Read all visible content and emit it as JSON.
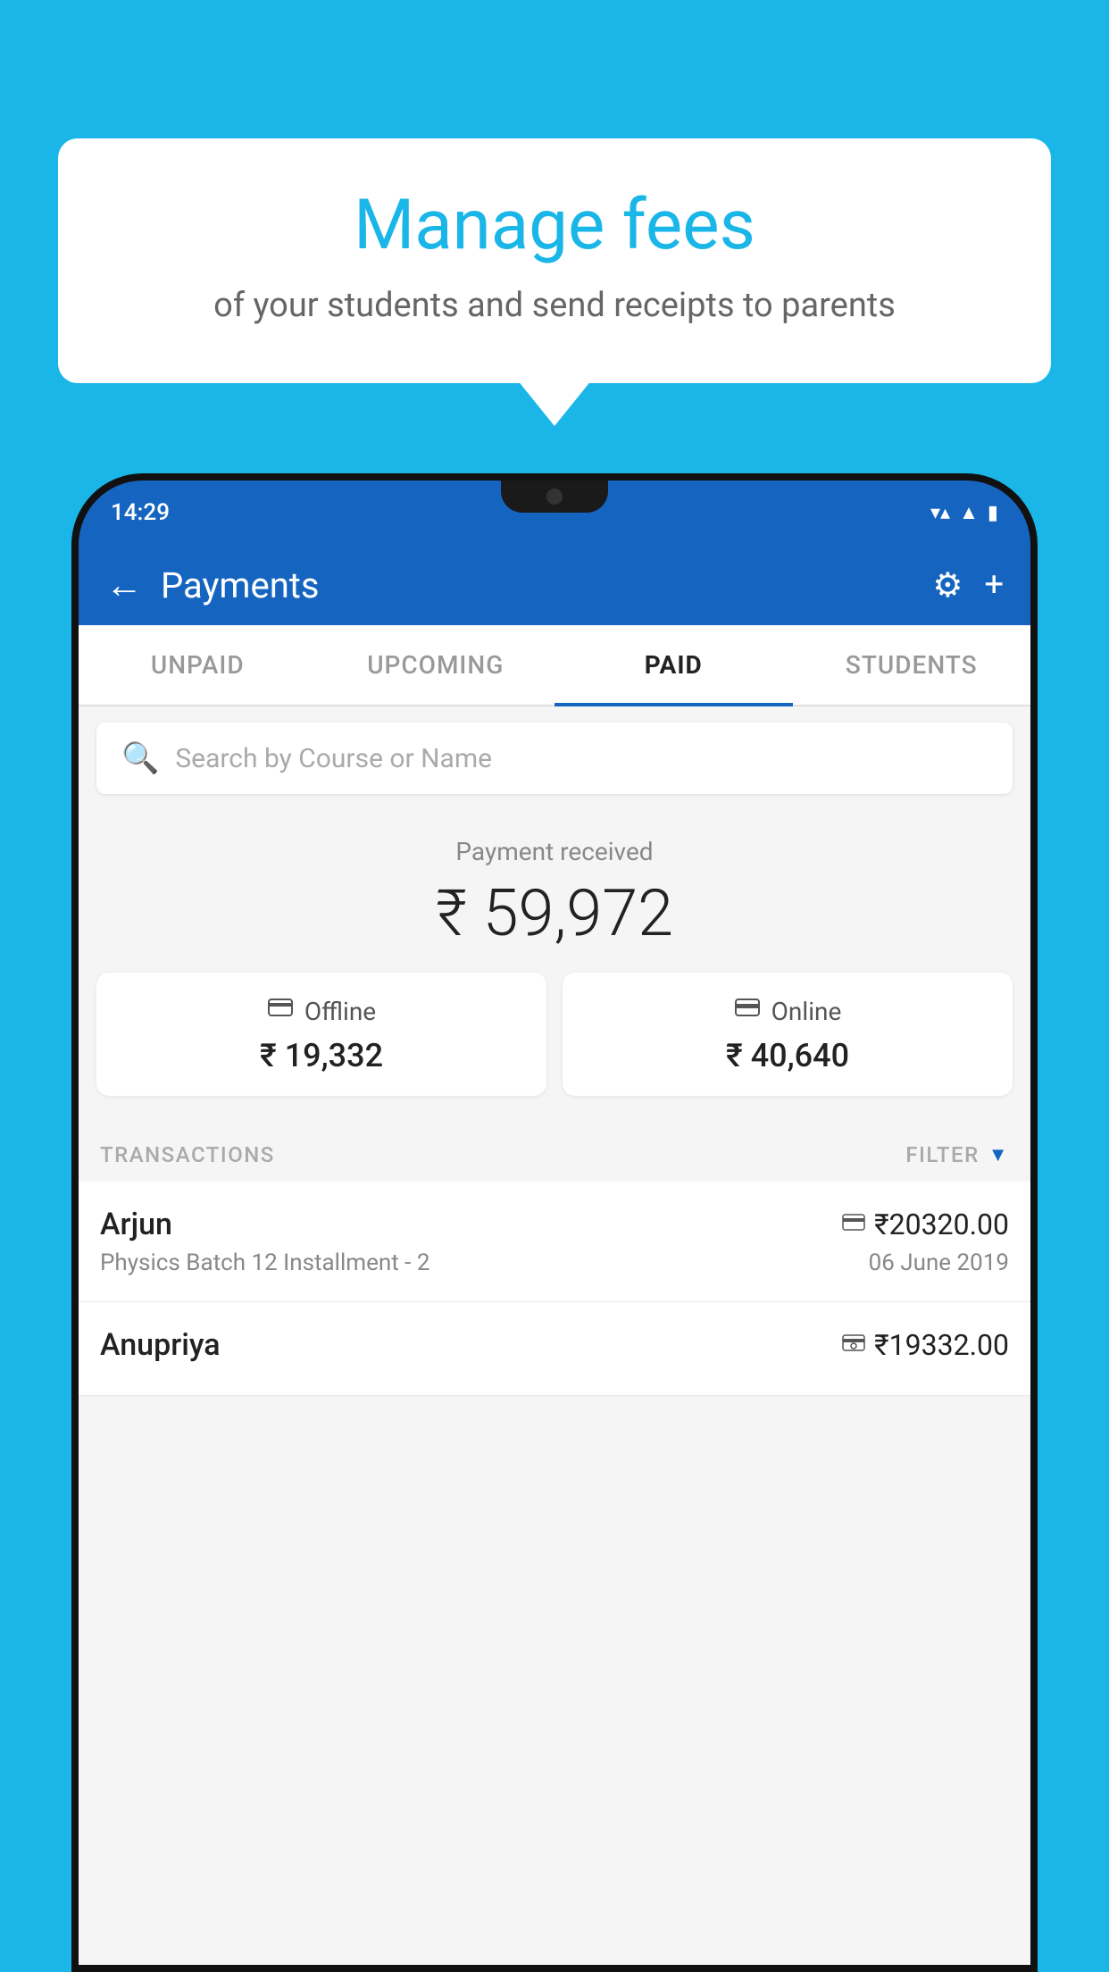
{
  "background_color": "#1ab6e8",
  "speech_bubble": {
    "title": "Manage fees",
    "subtitle": "of your students and send receipts to parents"
  },
  "phone": {
    "status_bar": {
      "time": "14:29",
      "wifi": "▼▲",
      "signal": "▲",
      "battery": "▮"
    },
    "header": {
      "back_label": "←",
      "title": "Payments",
      "gear_icon": "⚙",
      "plus_icon": "+"
    },
    "tabs": [
      {
        "label": "UNPAID",
        "active": false
      },
      {
        "label": "UPCOMING",
        "active": false
      },
      {
        "label": "PAID",
        "active": true
      },
      {
        "label": "STUDENTS",
        "active": false
      }
    ],
    "search": {
      "placeholder": "Search by Course or Name"
    },
    "payment_summary": {
      "label": "Payment received",
      "total": "₹ 59,972",
      "offline_label": "Offline",
      "offline_amount": "₹ 19,332",
      "online_label": "Online",
      "online_amount": "₹ 40,640"
    },
    "transactions": {
      "section_label": "TRANSACTIONS",
      "filter_label": "FILTER",
      "rows": [
        {
          "name": "Arjun",
          "course": "Physics Batch 12 Installment - 2",
          "date": "06 June 2019",
          "amount": "₹20320.00",
          "payment_type": "online"
        },
        {
          "name": "Anupriya",
          "course": "",
          "date": "",
          "amount": "₹19332.00",
          "payment_type": "offline"
        }
      ]
    }
  }
}
